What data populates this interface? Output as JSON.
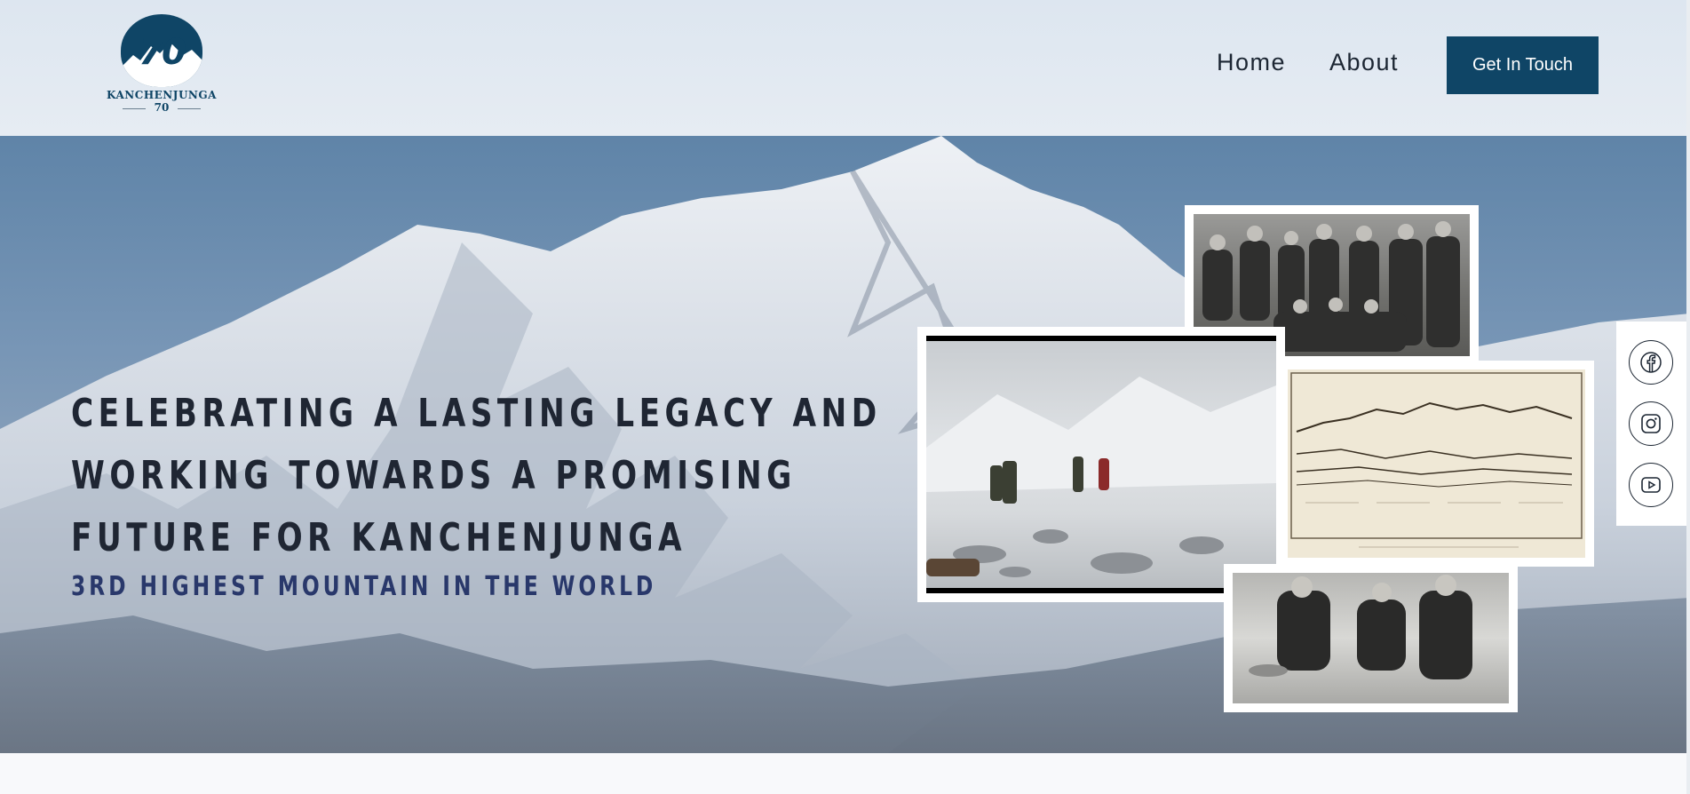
{
  "header": {
    "logo": {
      "number": "70",
      "name": "KANCHENJUNGA",
      "sub": "70"
    },
    "nav": [
      {
        "label": "Home"
      },
      {
        "label": "About"
      }
    ],
    "cta_label": "Get In Touch"
  },
  "hero": {
    "headline_lines": [
      "CELEBRATING A LASTING LEGACY AND",
      "WORKING TOWARDS A PROMISING",
      "FUTURE FOR KANCHENJUNGA"
    ],
    "subheadline": "3RD HIGHEST MOUNTAIN IN THE WORLD"
  },
  "social": [
    {
      "icon": "facebook-icon"
    },
    {
      "icon": "instagram-icon"
    },
    {
      "icon": "youtube-icon"
    }
  ],
  "colors": {
    "brand": "#0f4566",
    "headline": "#1f2633",
    "subheadline": "#29386b"
  }
}
